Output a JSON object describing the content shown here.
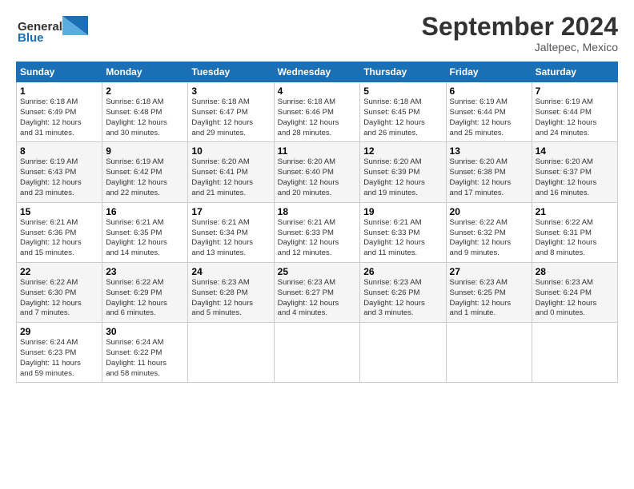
{
  "header": {
    "logo_general": "General",
    "logo_blue": "Blue",
    "month_title": "September 2024",
    "location": "Jaltepec, Mexico"
  },
  "days_of_week": [
    "Sunday",
    "Monday",
    "Tuesday",
    "Wednesday",
    "Thursday",
    "Friday",
    "Saturday"
  ],
  "weeks": [
    [
      {
        "day": "1",
        "info": "Sunrise: 6:18 AM\nSunset: 6:49 PM\nDaylight: 12 hours\nand 31 minutes."
      },
      {
        "day": "2",
        "info": "Sunrise: 6:18 AM\nSunset: 6:48 PM\nDaylight: 12 hours\nand 30 minutes."
      },
      {
        "day": "3",
        "info": "Sunrise: 6:18 AM\nSunset: 6:47 PM\nDaylight: 12 hours\nand 29 minutes."
      },
      {
        "day": "4",
        "info": "Sunrise: 6:18 AM\nSunset: 6:46 PM\nDaylight: 12 hours\nand 28 minutes."
      },
      {
        "day": "5",
        "info": "Sunrise: 6:18 AM\nSunset: 6:45 PM\nDaylight: 12 hours\nand 26 minutes."
      },
      {
        "day": "6",
        "info": "Sunrise: 6:19 AM\nSunset: 6:44 PM\nDaylight: 12 hours\nand 25 minutes."
      },
      {
        "day": "7",
        "info": "Sunrise: 6:19 AM\nSunset: 6:44 PM\nDaylight: 12 hours\nand 24 minutes."
      }
    ],
    [
      {
        "day": "8",
        "info": "Sunrise: 6:19 AM\nSunset: 6:43 PM\nDaylight: 12 hours\nand 23 minutes."
      },
      {
        "day": "9",
        "info": "Sunrise: 6:19 AM\nSunset: 6:42 PM\nDaylight: 12 hours\nand 22 minutes."
      },
      {
        "day": "10",
        "info": "Sunrise: 6:20 AM\nSunset: 6:41 PM\nDaylight: 12 hours\nand 21 minutes."
      },
      {
        "day": "11",
        "info": "Sunrise: 6:20 AM\nSunset: 6:40 PM\nDaylight: 12 hours\nand 20 minutes."
      },
      {
        "day": "12",
        "info": "Sunrise: 6:20 AM\nSunset: 6:39 PM\nDaylight: 12 hours\nand 19 minutes."
      },
      {
        "day": "13",
        "info": "Sunrise: 6:20 AM\nSunset: 6:38 PM\nDaylight: 12 hours\nand 17 minutes."
      },
      {
        "day": "14",
        "info": "Sunrise: 6:20 AM\nSunset: 6:37 PM\nDaylight: 12 hours\nand 16 minutes."
      }
    ],
    [
      {
        "day": "15",
        "info": "Sunrise: 6:21 AM\nSunset: 6:36 PM\nDaylight: 12 hours\nand 15 minutes."
      },
      {
        "day": "16",
        "info": "Sunrise: 6:21 AM\nSunset: 6:35 PM\nDaylight: 12 hours\nand 14 minutes."
      },
      {
        "day": "17",
        "info": "Sunrise: 6:21 AM\nSunset: 6:34 PM\nDaylight: 12 hours\nand 13 minutes."
      },
      {
        "day": "18",
        "info": "Sunrise: 6:21 AM\nSunset: 6:33 PM\nDaylight: 12 hours\nand 12 minutes."
      },
      {
        "day": "19",
        "info": "Sunrise: 6:21 AM\nSunset: 6:33 PM\nDaylight: 12 hours\nand 11 minutes."
      },
      {
        "day": "20",
        "info": "Sunrise: 6:22 AM\nSunset: 6:32 PM\nDaylight: 12 hours\nand 9 minutes."
      },
      {
        "day": "21",
        "info": "Sunrise: 6:22 AM\nSunset: 6:31 PM\nDaylight: 12 hours\nand 8 minutes."
      }
    ],
    [
      {
        "day": "22",
        "info": "Sunrise: 6:22 AM\nSunset: 6:30 PM\nDaylight: 12 hours\nand 7 minutes."
      },
      {
        "day": "23",
        "info": "Sunrise: 6:22 AM\nSunset: 6:29 PM\nDaylight: 12 hours\nand 6 minutes."
      },
      {
        "day": "24",
        "info": "Sunrise: 6:23 AM\nSunset: 6:28 PM\nDaylight: 12 hours\nand 5 minutes."
      },
      {
        "day": "25",
        "info": "Sunrise: 6:23 AM\nSunset: 6:27 PM\nDaylight: 12 hours\nand 4 minutes."
      },
      {
        "day": "26",
        "info": "Sunrise: 6:23 AM\nSunset: 6:26 PM\nDaylight: 12 hours\nand 3 minutes."
      },
      {
        "day": "27",
        "info": "Sunrise: 6:23 AM\nSunset: 6:25 PM\nDaylight: 12 hours\nand 1 minute."
      },
      {
        "day": "28",
        "info": "Sunrise: 6:23 AM\nSunset: 6:24 PM\nDaylight: 12 hours\nand 0 minutes."
      }
    ],
    [
      {
        "day": "29",
        "info": "Sunrise: 6:24 AM\nSunset: 6:23 PM\nDaylight: 11 hours\nand 59 minutes."
      },
      {
        "day": "30",
        "info": "Sunrise: 6:24 AM\nSunset: 6:22 PM\nDaylight: 11 hours\nand 58 minutes."
      },
      {
        "day": "",
        "info": ""
      },
      {
        "day": "",
        "info": ""
      },
      {
        "day": "",
        "info": ""
      },
      {
        "day": "",
        "info": ""
      },
      {
        "day": "",
        "info": ""
      }
    ]
  ]
}
